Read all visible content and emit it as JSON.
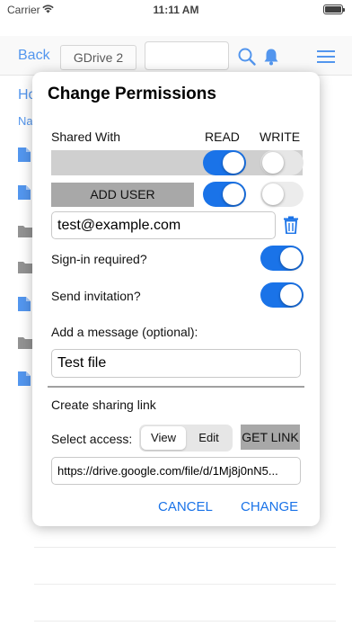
{
  "status_bar": {
    "carrier": "Carrier",
    "time": "11:11 AM"
  },
  "nav": {
    "back": "Back",
    "account": "GDrive 2"
  },
  "background": {
    "breadcrumb": "Ho",
    "column_header": "Na"
  },
  "dialog": {
    "title": "Change Permissions",
    "shared_with_label": "Shared With",
    "read_label": "READ",
    "write_label": "WRITE",
    "add_user_label": "ADD USER",
    "email_value": "test@example.com",
    "signin_label": "Sign-in required?",
    "invitation_label": "Send invitation?",
    "message_label": "Add a message (optional):",
    "message_value": "Test file",
    "sharing_link_label": "Create sharing link",
    "select_access_label": "Select access:",
    "access_options": [
      "View",
      "Edit"
    ],
    "access_selected": "View",
    "get_link_label": "GET LINK",
    "link_value": "https://drive.google.com/file/d/1Mj8j0nN5...",
    "cancel_label": "CANCEL",
    "change_label": "CHANGE"
  },
  "toggles": {
    "existing_user_read": true,
    "existing_user_write": false,
    "new_user_read": true,
    "new_user_write": false,
    "signin_required": true,
    "send_invitation": true
  },
  "colors": {
    "accent": "#1a73e8",
    "button_gray": "#a8a8a8",
    "row_gray": "#cfcfcf"
  },
  "icons": [
    "wifi-icon",
    "battery-icon",
    "search-icon",
    "bell-icon",
    "menu-icon",
    "file-icon",
    "folder-icon",
    "trash-icon"
  ]
}
